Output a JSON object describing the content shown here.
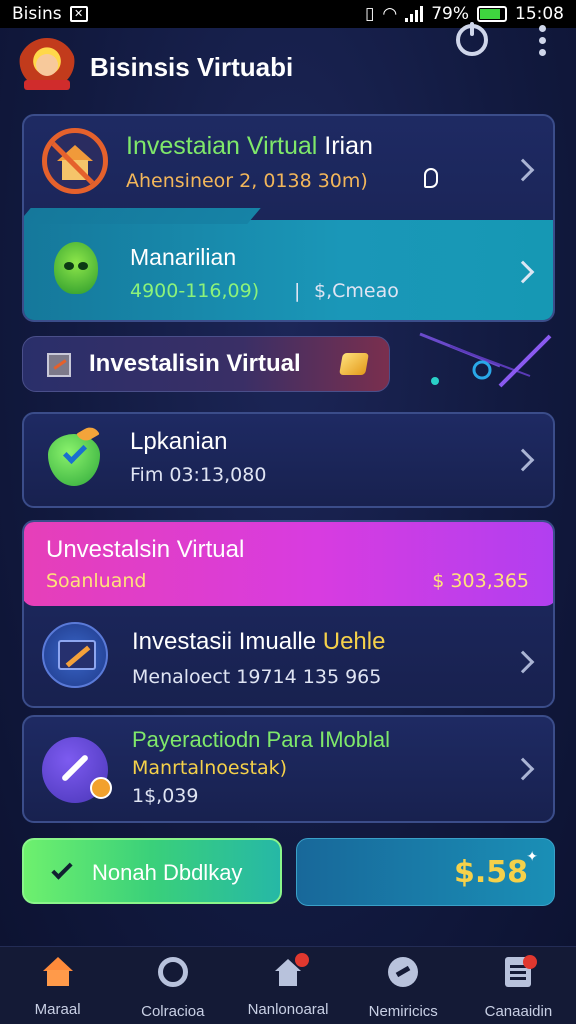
{
  "status_bar": {
    "carrier": "Bisins",
    "battery": "79%",
    "time": "15:08"
  },
  "header": {
    "title": "Bisinsis Virtuabi"
  },
  "card1": {
    "title_prefix": "Investaian Virtual",
    "title_suffix": "Irian",
    "subtitle": "Ahensineor 2, 0138 30m)",
    "sub_title": "Manarilian",
    "sub_value": "4900-116,09)",
    "sub_divider": "|",
    "sub_right": "$,Cmeao"
  },
  "pill": {
    "label": "Investalisin Virtual"
  },
  "card2": {
    "title": "Lpkanian",
    "subtitle": "Fim 03:13,080"
  },
  "card3": {
    "banner_title": "Unvestalsin Virtual",
    "banner_sub": "Soanluand",
    "banner_amount": "$ 303,365",
    "title_prefix": "Investasii Imualle",
    "title_suffix": "Uehle",
    "subtitle": "Menaloect 19714 135 965"
  },
  "card4": {
    "title": "Payeractiodn Para IMoblal",
    "subtitle": "Manrtalnoestak)",
    "amount": "1$,039"
  },
  "buttons": {
    "green_label": "Nonah Dbdlkay",
    "blue_amount": "$.58"
  },
  "nav": [
    {
      "label": "Maraal"
    },
    {
      "label": "Colracioa"
    },
    {
      "label": "Nanlonoaral"
    },
    {
      "label": "Nemiricics"
    },
    {
      "label": "Canaaidin"
    }
  ],
  "colors": {
    "accent_green": "#6ef06e",
    "accent_magenta": "#e63fb8",
    "accent_teal": "#1a97b8",
    "accent_gold": "#f5d14a"
  }
}
